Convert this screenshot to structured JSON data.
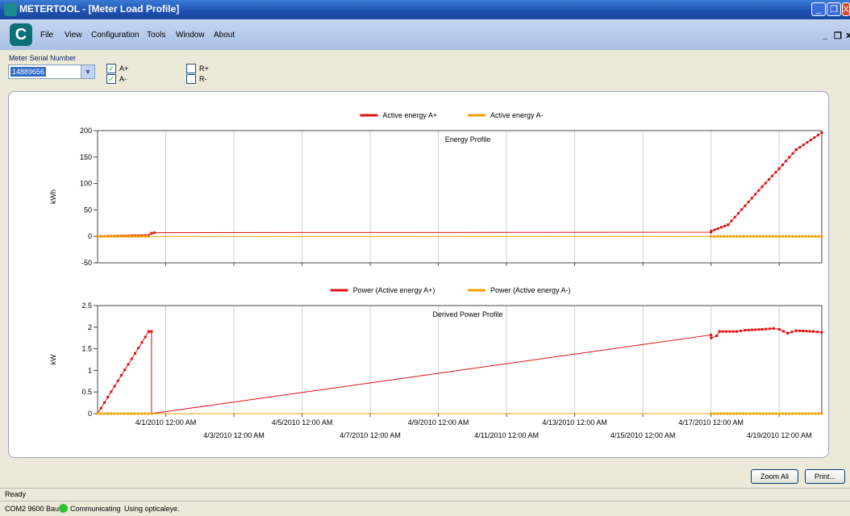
{
  "window": {
    "title": "METERTOOL - [Meter Load Profile]",
    "minimize": "_",
    "restore": "❐",
    "close": "X"
  },
  "menu": {
    "items": [
      "File",
      "View",
      "Configuration",
      "Tools",
      "Window",
      "About"
    ],
    "mdi_min": "_",
    "mdi_restore": "❐",
    "mdi_close": "x"
  },
  "toolbar": {
    "serial_label": "Meter Serial Number",
    "serial_value": "14889656",
    "checks": [
      {
        "label": "A+",
        "checked": true,
        "mark": "✓"
      },
      {
        "label": "A-",
        "checked": true,
        "mark": "✓"
      },
      {
        "label": "R+",
        "checked": false,
        "mark": ""
      },
      {
        "label": "R-",
        "checked": false,
        "mark": ""
      }
    ]
  },
  "chart_data": [
    {
      "type": "line",
      "title": "Energy Profile",
      "ylabel": "kWh",
      "ylim": [
        -50,
        200
      ],
      "yticks": [
        -50,
        0,
        50,
        100,
        150,
        200
      ],
      "x_start": "3/30/2010 00:00",
      "x_end": "4/20/2010 06:00",
      "grid": true,
      "legend_placement": "top",
      "series": [
        {
          "name": "Active energy A+",
          "color": "#e01010",
          "points": [
            [
              "3/30/2010 00:00",
              0
            ],
            [
              "3/31/2010 12:00",
              2
            ],
            [
              "3/31/2010 14:00",
              6
            ],
            [
              "3/31/2010 16:00",
              7
            ],
            [
              "4/17/2010 00:00",
              8
            ],
            [
              "4/17/2010 00:10",
              10
            ],
            [
              "4/17/2010 12:00",
              22
            ],
            [
              "4/18/2010 00:00",
              58
            ],
            [
              "4/18/2010 12:00",
              94
            ],
            [
              "4/19/2010 00:00",
              128
            ],
            [
              "4/19/2010 12:00",
              164
            ],
            [
              "4/20/2010 06:00",
              196
            ]
          ]
        },
        {
          "name": "Active energy A-",
          "color": "#f0a000",
          "points": [
            [
              "3/30/2010 00:00",
              0
            ],
            [
              "3/31/2010 12:00",
              0
            ],
            [
              "4/17/2010 00:00",
              0
            ],
            [
              "4/20/2010 06:00",
              0
            ]
          ]
        }
      ]
    },
    {
      "type": "line",
      "title": "Derived Power Profile",
      "ylabel": "kW",
      "ylim": [
        0,
        2.5
      ],
      "yticks": [
        0,
        0.5,
        1,
        1.5,
        2,
        2.5
      ],
      "x_start": "3/30/2010 00:00",
      "x_end": "4/20/2010 06:00",
      "grid": true,
      "legend_placement": "top",
      "xticks_top": [
        "4/1/2010 12:00 AM",
        "4/5/2010 12:00 AM",
        "4/9/2010 12:00 AM",
        "4/13/2010 12:00 AM",
        "4/17/2010 12:00 AM"
      ],
      "xticks_bottom": [
        "4/3/2010 12:00 AM",
        "4/7/2010 12:00 AM",
        "4/11/2010 12:00 AM",
        "4/15/2010 12:00 AM",
        "4/19/2010 12:00 AM"
      ],
      "series": [
        {
          "name": "Power (Active energy A+)",
          "color": "#e01010",
          "points": [
            [
              "3/30/2010 00:00",
              0
            ],
            [
              "3/31/2010 12:00",
              1.9
            ],
            [
              "3/31/2010 14:00",
              1.9
            ],
            [
              "3/31/2010 14:00",
              0
            ],
            [
              "4/17/2010 00:00",
              1.82
            ],
            [
              "4/17/2010 00:10",
              1.75
            ],
            [
              "4/17/2010 04:00",
              1.8
            ],
            [
              "4/17/2010 06:00",
              1.9
            ],
            [
              "4/17/2010 18:00",
              1.9
            ],
            [
              "4/18/2010 00:00",
              1.93
            ],
            [
              "4/18/2010 12:00",
              1.95
            ],
            [
              "4/18/2010 20:00",
              1.97
            ],
            [
              "4/19/2010 00:00",
              1.95
            ],
            [
              "4/19/2010 06:00",
              1.86
            ],
            [
              "4/19/2010 12:00",
              1.92
            ],
            [
              "4/20/2010 00:00",
              1.9
            ],
            [
              "4/20/2010 06:00",
              1.88
            ]
          ]
        },
        {
          "name": "Power (Active energy A-)",
          "color": "#f0a000",
          "points": [
            [
              "3/30/2010 00:00",
              0
            ],
            [
              "3/31/2010 14:00",
              0
            ],
            [
              "4/17/2010 00:00",
              0
            ],
            [
              "4/20/2010 06:00",
              0
            ]
          ]
        }
      ]
    }
  ],
  "buttons": {
    "zoom_all": "Zoom All",
    "print": "Print..."
  },
  "status": {
    "ready": "Ready",
    "port": "COM2 9600 Baud",
    "comm": "Communicating",
    "using": "Using opticaleye."
  }
}
